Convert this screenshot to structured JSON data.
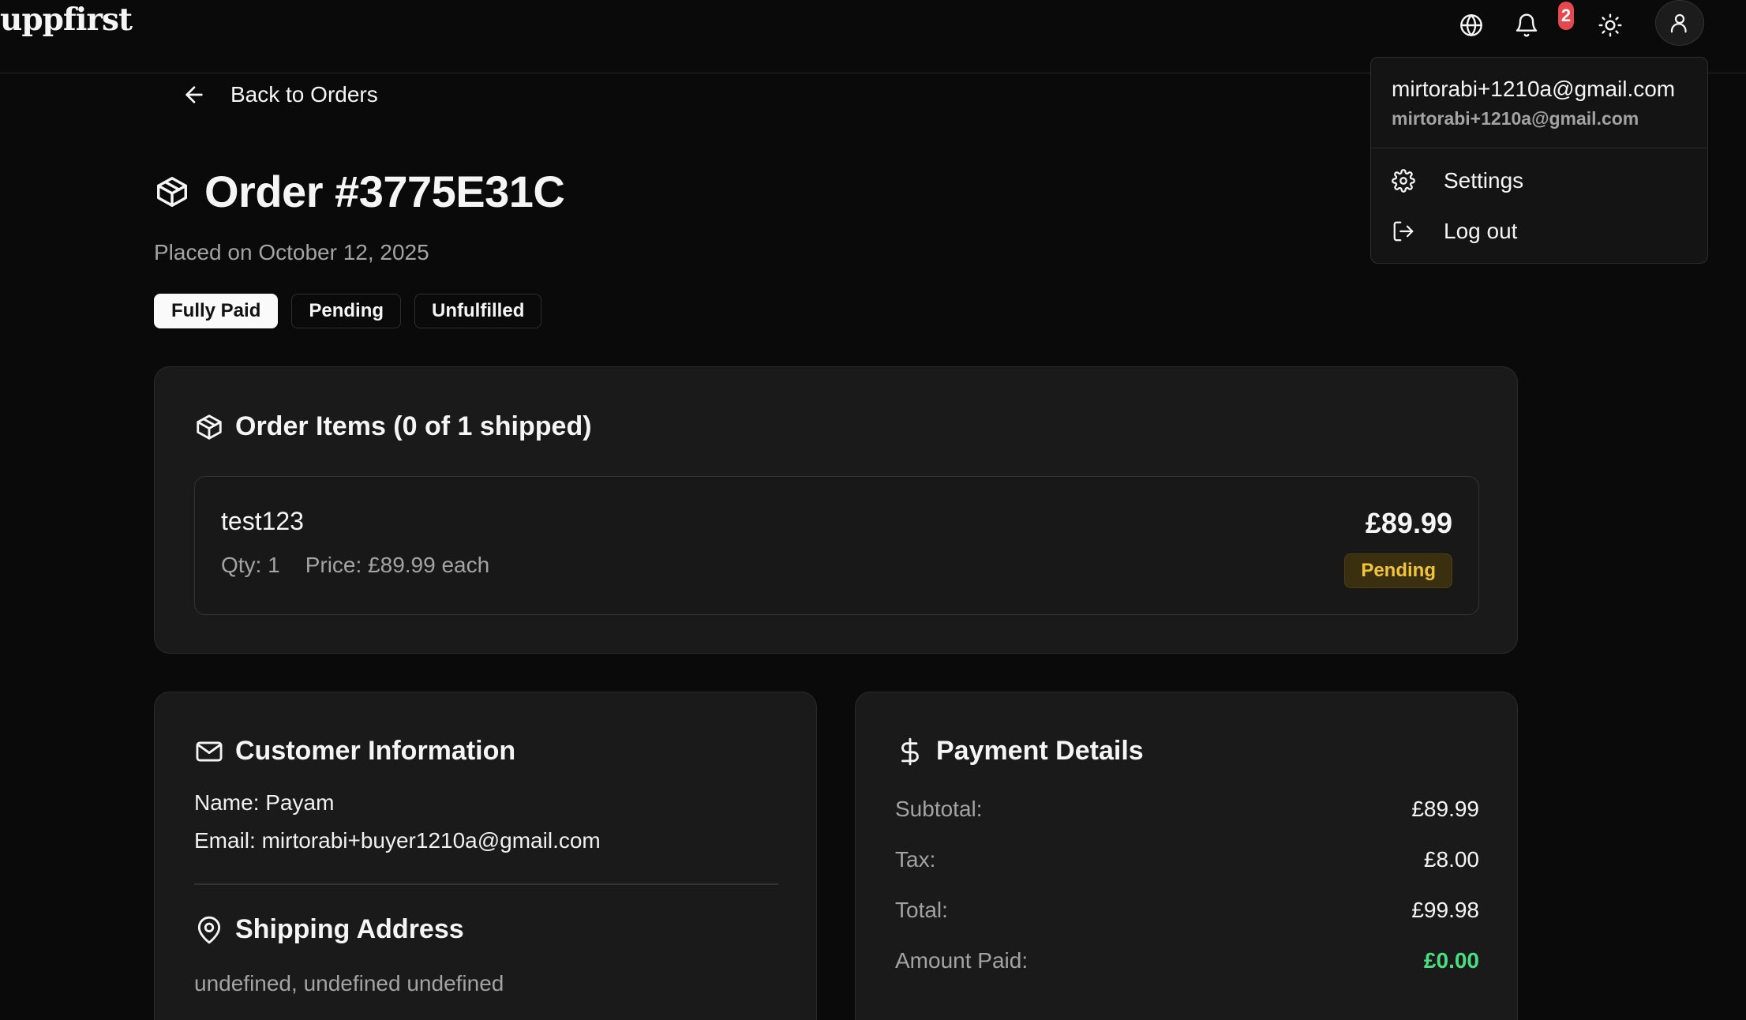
{
  "brand": {
    "logo_text": "uppfirst"
  },
  "topbar": {
    "icons": [
      "globe-icon",
      "bell-icon",
      "sun-icon",
      "user-icon"
    ],
    "notification_count": "2"
  },
  "nav": {
    "back_label": "Back to Orders"
  },
  "order": {
    "title": "Order #3775E31C",
    "placed_on": "Placed on October 12, 2025",
    "badges": [
      "Fully Paid",
      "Pending",
      "Unfulfilled"
    ]
  },
  "items_section": {
    "title": "Order Items (0 of 1 shipped)",
    "items": [
      {
        "name": "test123",
        "qty": "Qty: 1",
        "price_each": "Price: £89.99 each",
        "total": "£89.99",
        "status": "Pending"
      }
    ]
  },
  "customer": {
    "title": "Customer Information",
    "name": "Name: Payam",
    "email": "Email: mirtorabi+buyer1210a@gmail.com",
    "shipping_title": "Shipping Address",
    "address": "undefined, undefined undefined"
  },
  "payment": {
    "title": "Payment Details",
    "rows": [
      {
        "label": "Subtotal:",
        "value": "£89.99"
      },
      {
        "label": "Tax:",
        "value": "£8.00"
      },
      {
        "label": "Total:",
        "value": "£99.98"
      },
      {
        "label": "Amount Paid:",
        "value": "£0.00"
      }
    ]
  },
  "user_menu": {
    "email": "mirtorabi+1210a@gmail.com",
    "email_secondary": "mirtorabi+1210a@gmail.com",
    "settings_label": "Settings",
    "logout_label": "Log out"
  },
  "colors": {
    "background": "#0a0a0a",
    "card": "#1a1a1a",
    "pending_text": "#f2c43a",
    "paid_green": "#4ade80",
    "badge_red": "#e5484d"
  }
}
